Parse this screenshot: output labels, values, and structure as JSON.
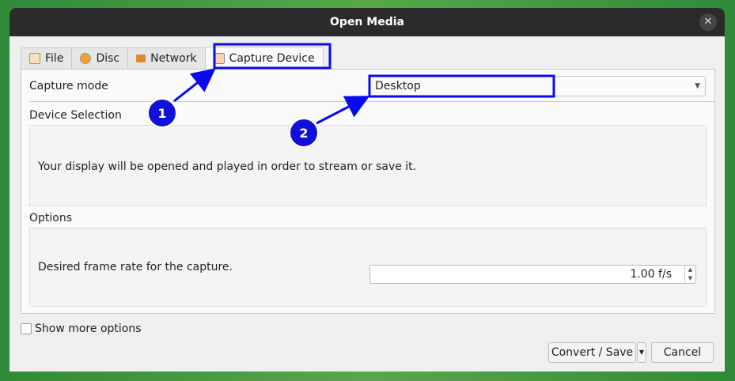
{
  "window": {
    "title": "Open Media"
  },
  "tabs": [
    {
      "label": "File"
    },
    {
      "label": "Disc"
    },
    {
      "label": "Network"
    },
    {
      "label": "Capture Device"
    }
  ],
  "capture": {
    "mode_label": "Capture mode",
    "mode_value": "Desktop",
    "device_selection_label": "Device Selection",
    "device_text": "Your display will be opened and played in order to stream or save it.",
    "options_label": "Options",
    "frame_rate_label": "Desired frame rate for the capture.",
    "frame_rate_value": "1.00 f/s"
  },
  "footer": {
    "show_more": "Show more options",
    "convert_save": "Convert / Save",
    "cancel": "Cancel"
  },
  "annotations": {
    "marker1": "1",
    "marker2": "2",
    "color": "#0a0af0"
  }
}
